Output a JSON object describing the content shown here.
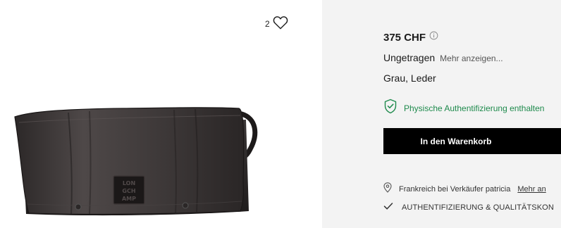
{
  "gallery": {
    "like_count": "2",
    "heart_icon": "heart-outline-icon",
    "image_logo_text": "LONGCHAMP"
  },
  "panel": {
    "price": "375 CHF",
    "info_icon": "info-circle-icon",
    "condition": "Ungetragen",
    "show_more": "Mehr anzeigen...",
    "material": "Grau, Leder",
    "authentication": "Physische Authentifizierung enthalten",
    "shield_icon": "shield-check-icon",
    "add_to_cart": "In den Warenkorb",
    "location": "Frankreich bei Verkäufer patricia",
    "location_link": "Mehr an",
    "location_icon": "location-pin-icon",
    "auth_service": "AUTHENTIFIZIERUNG & QUALITÄTSKON",
    "check_icon": "checkmark-icon"
  },
  "colors": {
    "panel_bg": "#f3f3f3",
    "auth_green": "#1e8a4c",
    "button_bg": "#000000",
    "button_text": "#ffffff"
  }
}
